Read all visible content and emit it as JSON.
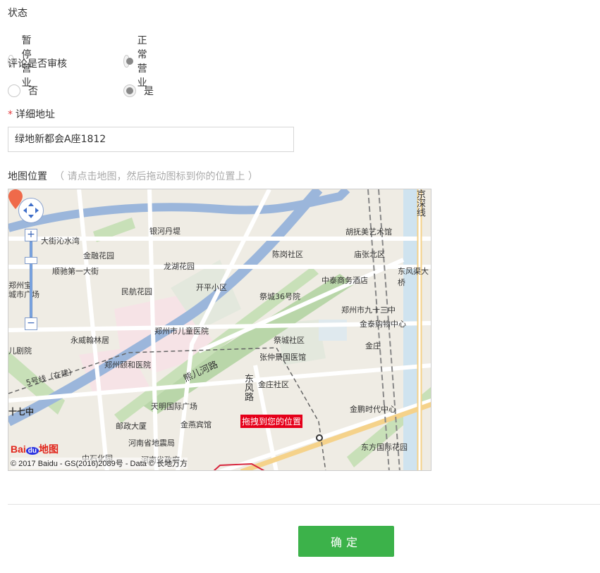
{
  "status": {
    "label": "状态",
    "options": [
      {
        "label": "暂停营业",
        "selected": false
      },
      {
        "label": "正常营业",
        "selected": true
      }
    ]
  },
  "review": {
    "label": "评论是否审核",
    "options": [
      {
        "label": "否",
        "selected": false
      },
      {
        "label": "是",
        "selected": true
      }
    ]
  },
  "address": {
    "required_mark": "*",
    "label": "详细地址",
    "value": "绿地新都会A座1812"
  },
  "map": {
    "label": "地图位置",
    "hint": "（ 请点击地图，然后拖动图标到你的位置上 ）",
    "marker_tip": "拖拽到您的位置",
    "copyright": "© 2017 Baidu - GS(2016)2089号 - Data © 长地万方",
    "logo": {
      "bai": "Bai",
      "du": "du",
      "ditu": "地图"
    },
    "zoom_in": "+",
    "zoom_out": "−",
    "places": [
      "银河丹堤",
      "胡抚美艺术馆",
      "大街沁水湾",
      "金融花园",
      "陈岗社区",
      "庙张北区",
      "顺驰第一大街",
      "龙湖花园",
      "中泰商务酒店",
      "东风渠大桥",
      "民航花园",
      "开平小区",
      "祭城36号院",
      "郑州市九十三中",
      "郑州市儿童医院",
      "金泰购物中心",
      "永威翰林居",
      "祭城社区",
      "金庄",
      "张仲景国医馆",
      "郑州颐和医院",
      "金庄社区",
      "天明国际广场",
      "金鹏时代中心",
      "邮政大厦",
      "金燕宾馆",
      "河南省地震局",
      "东方国际花园",
      "中石化园",
      "河南省政府",
      "熊儿河路",
      "东风路",
      "京深线",
      "5号线（在建）",
      "十七中",
      "儿剧院",
      "郑州宝",
      "城市广场"
    ]
  },
  "submit": {
    "label": "确定"
  }
}
